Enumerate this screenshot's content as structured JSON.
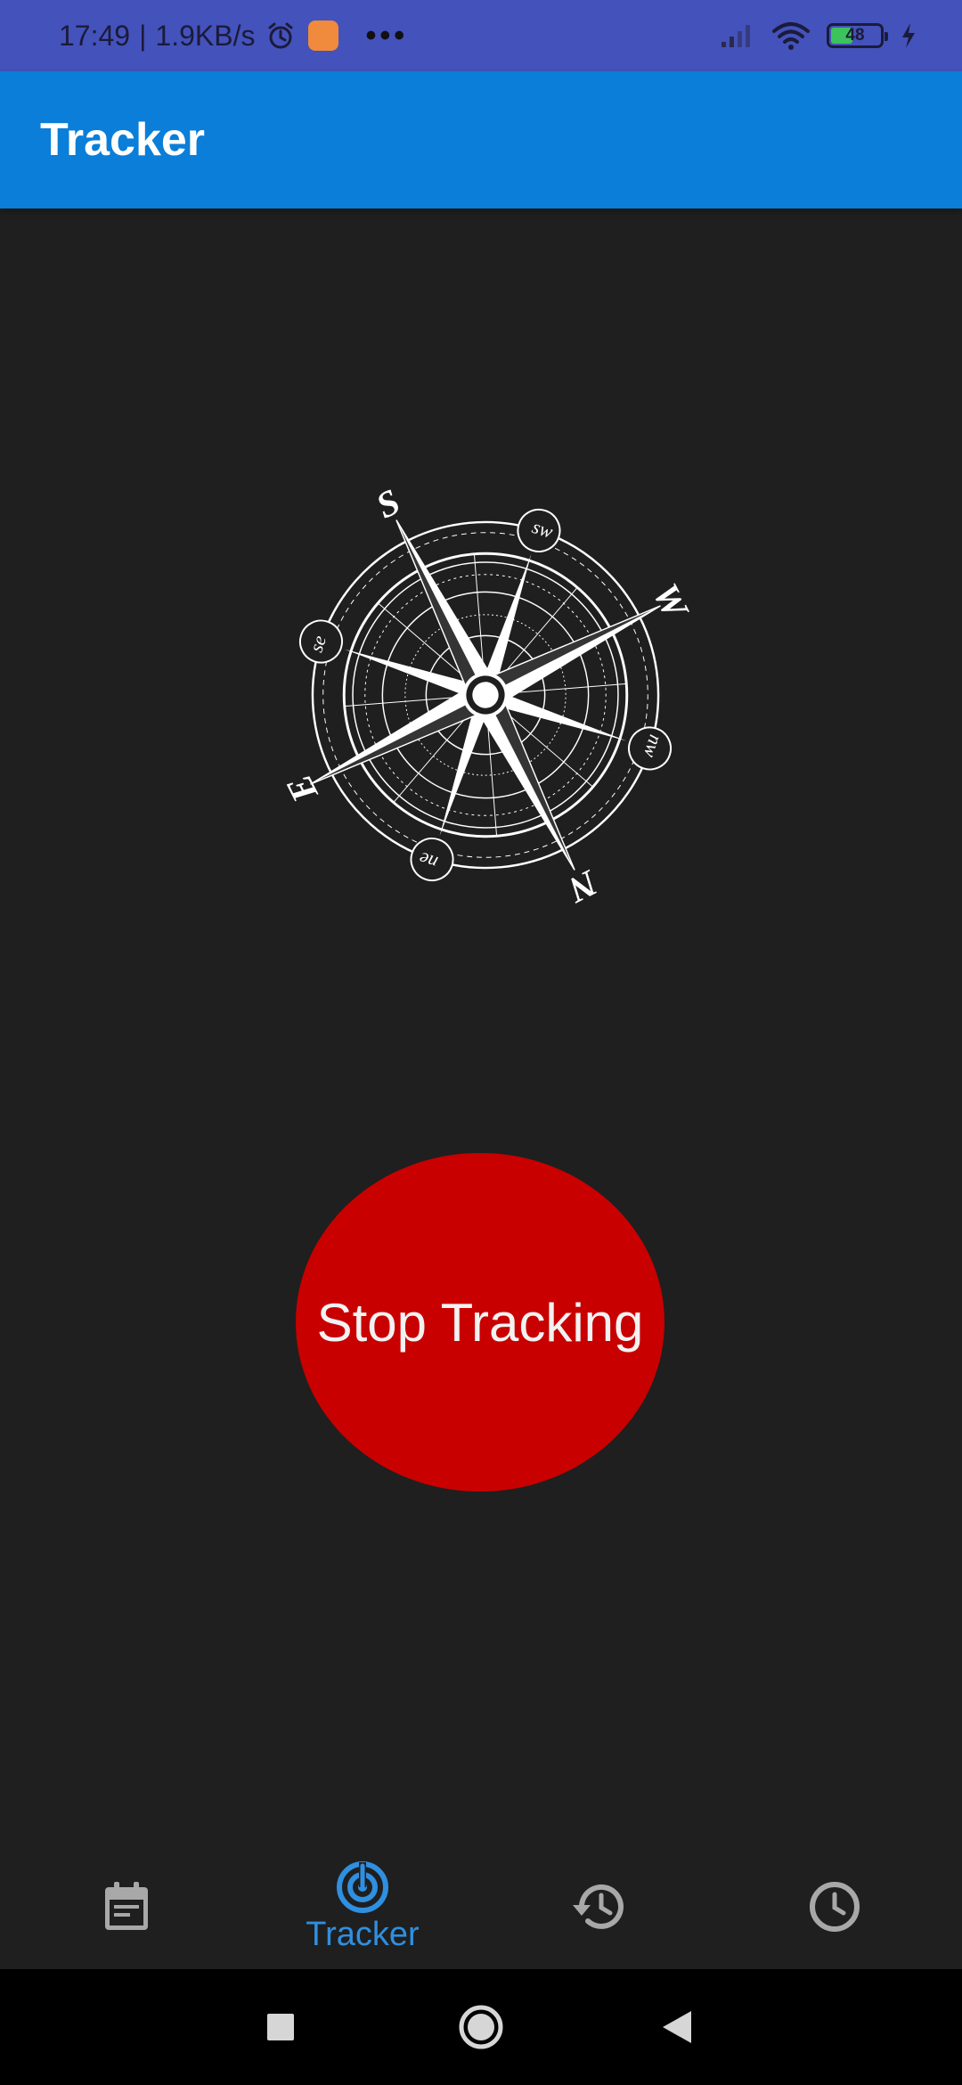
{
  "status_bar": {
    "time": "17:49",
    "separator": "|",
    "net_speed": "1.9KB/s",
    "battery_level": "48",
    "battery_fraction": 0.48,
    "icons": [
      "alarm-icon",
      "app-notification-icon",
      "more-icon",
      "signal-icon",
      "wifi-icon",
      "battery-icon",
      "charging-icon"
    ]
  },
  "app_bar": {
    "title": "Tracker",
    "color": "#0a7ed8"
  },
  "compass": {
    "icon": "compass-rose-icon",
    "labels": {
      "n": "N",
      "s": "S",
      "e": "E",
      "w": "W",
      "ne": "ne",
      "se": "se",
      "sw": "sw",
      "nw": "nw"
    }
  },
  "main": {
    "stop_button_label": "Stop Tracking",
    "stop_button_color": "#c90000"
  },
  "bottom_nav": {
    "items": [
      {
        "icon": "calendar-icon",
        "label": ""
      },
      {
        "icon": "radar-icon",
        "label": "Tracker",
        "active": true
      },
      {
        "icon": "history-icon",
        "label": ""
      },
      {
        "icon": "clock-icon",
        "label": ""
      }
    ],
    "active_color": "#2f8fe0",
    "inactive_color": "#a8a8a8"
  },
  "system_nav": {
    "icons": [
      "recents-square-icon",
      "home-circle-icon",
      "back-triangle-icon"
    ]
  }
}
